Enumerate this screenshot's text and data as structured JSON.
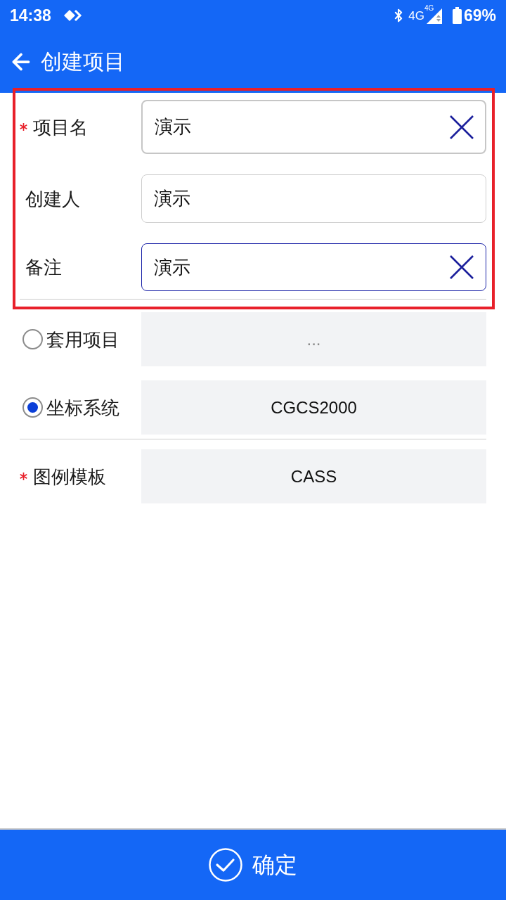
{
  "status_bar": {
    "time": "14:38",
    "network": "4G",
    "network_badge": "4G",
    "battery": "69%"
  },
  "app_bar": {
    "title": "创建项目"
  },
  "sections": [
    {
      "highlighted": true,
      "rows": [
        {
          "kind": "input",
          "label": "项目名",
          "required": true,
          "value": "演示",
          "clearable": true,
          "focused": false
        },
        {
          "kind": "input",
          "label": "创建人",
          "required": false,
          "value": "演示",
          "clearable": false,
          "focused": false
        },
        {
          "kind": "input",
          "label": "备注",
          "required": false,
          "value": "演示",
          "clearable": true,
          "focused": true
        }
      ]
    },
    {
      "highlighted": false,
      "rows": [
        {
          "kind": "radio",
          "label": "套用项目",
          "selected": false,
          "placeholder": "..."
        },
        {
          "kind": "radio",
          "label": "坐标系统",
          "selected": true,
          "value": "CGCS2000"
        }
      ]
    },
    {
      "highlighted": false,
      "rows": [
        {
          "kind": "select",
          "label": "图例模板",
          "required": true,
          "value": "CASS"
        }
      ]
    }
  ],
  "confirm_button": {
    "label": "确定"
  }
}
